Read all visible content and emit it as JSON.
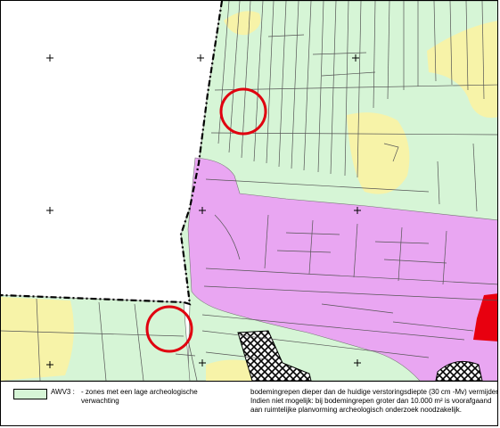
{
  "map": {
    "colors": {
      "background": "#ffffff",
      "low_expectation_zone": "#d6f5d6",
      "medium_zone": "#f7f3a8",
      "built_area": "#e9a6f2",
      "high_zone": "#e8000f",
      "parcel_lines": "#555555",
      "boundary": "#000000",
      "marker_circle": "#e0000f"
    },
    "markers": [
      "red-circle",
      "red-circle"
    ],
    "grid_symbol": "+"
  },
  "legend": {
    "swatch_color": "#d6f5d6",
    "code": "AWV3 :",
    "description_line1": "- zones met een lage archeologische",
    "description_line2": "verwachting",
    "note_line1": "bodemingrepen dieper dan de huidige verstoringsdiepte (30 cm -Mv) vermijden.",
    "note_line2": "Indien niet mogelijk: bij bodemingrepen groter dan 10.000 m² is voorafgaand",
    "note_line3": "aan ruimtelijke planvorming archeologisch onderzoek noodzakelijk."
  }
}
